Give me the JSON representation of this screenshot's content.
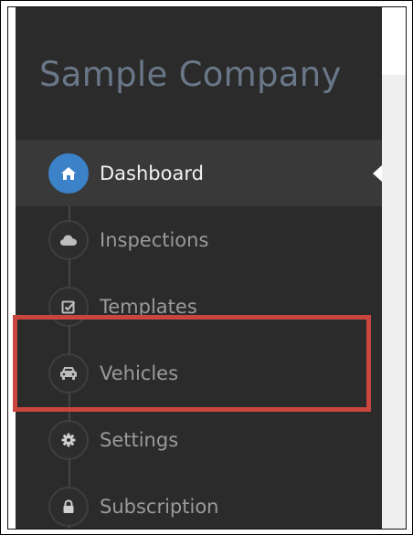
{
  "brand": {
    "name": "Sample Company"
  },
  "nav": {
    "items": [
      {
        "label": "Dashboard",
        "icon": "home-icon",
        "active": true
      },
      {
        "label": "Inspections",
        "icon": "cloud-icon",
        "active": false
      },
      {
        "label": "Templates",
        "icon": "checkbox-icon",
        "active": false
      },
      {
        "label": "Vehicles",
        "icon": "car-icon",
        "active": false
      },
      {
        "label": "Settings",
        "icon": "gear-icon",
        "active": false
      },
      {
        "label": "Subscription",
        "icon": "lock-icon",
        "active": false
      }
    ]
  },
  "colors": {
    "sidebar_bg": "#2b2b2b",
    "active_bg": "#393939",
    "accent": "#3c82c8",
    "brand_text": "#6a7788",
    "highlight": "#c9463f"
  },
  "annotation": {
    "highlighted_item": "Vehicles"
  }
}
